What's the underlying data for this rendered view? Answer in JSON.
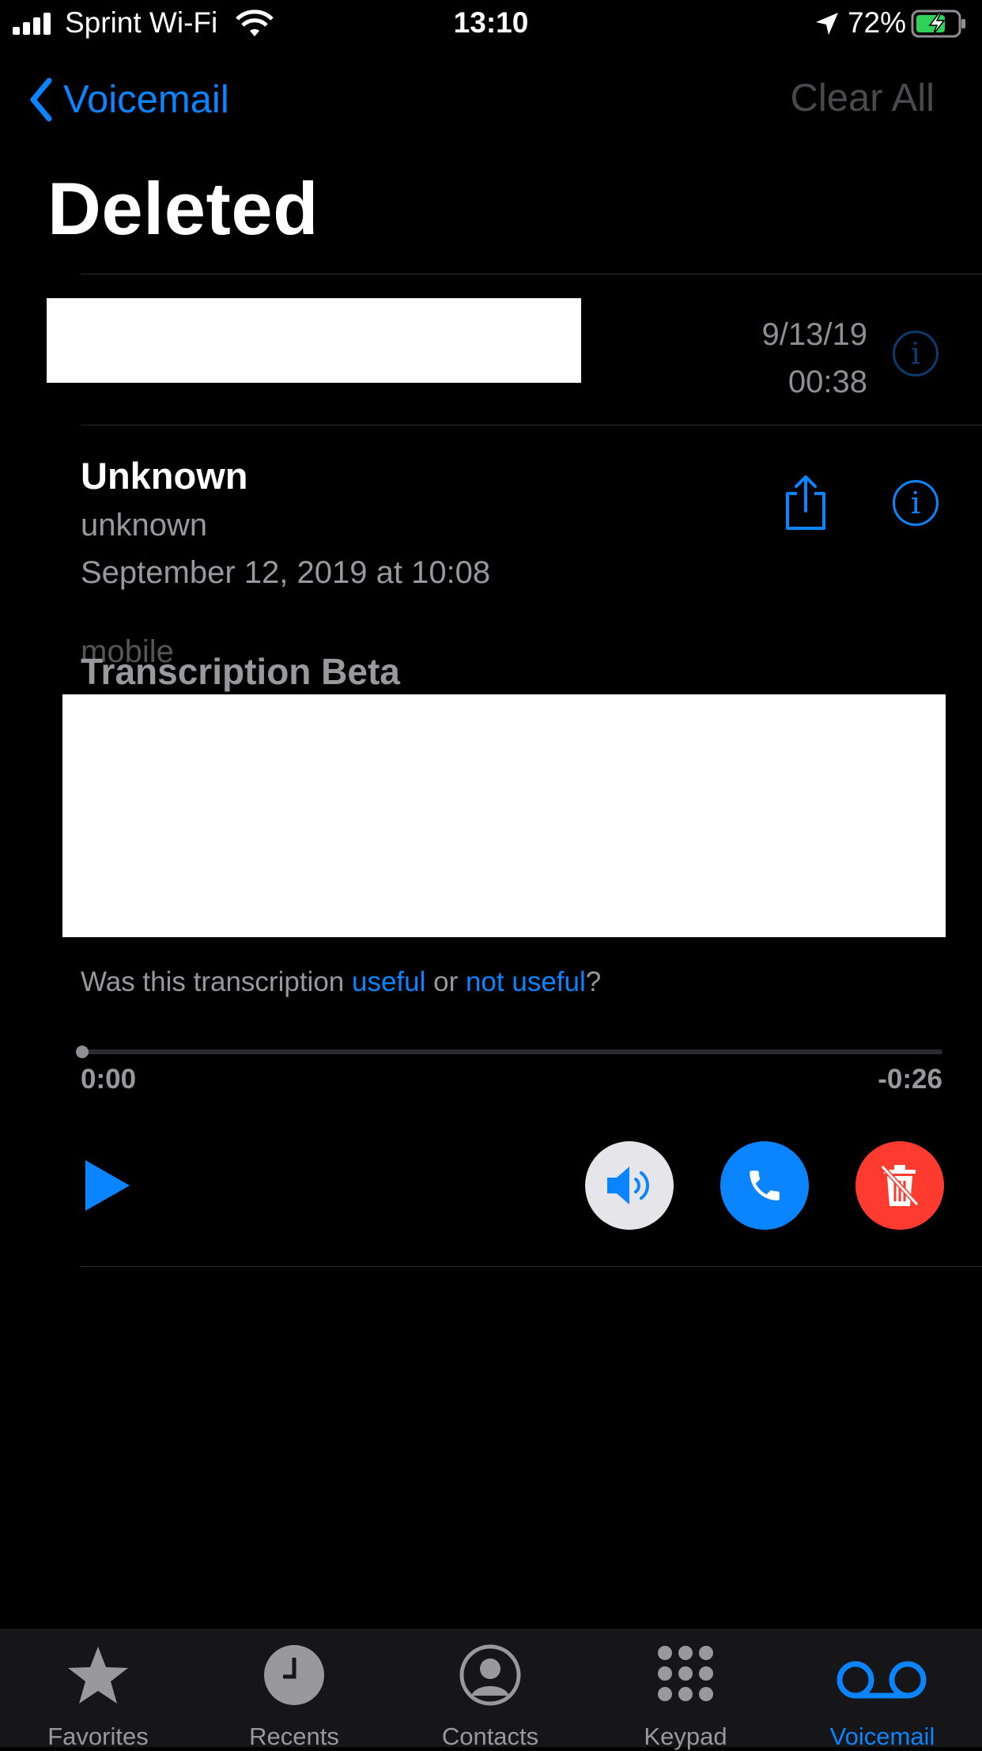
{
  "status": {
    "carrier": "Sprint Wi-Fi",
    "time": "13:10",
    "battery": "72%"
  },
  "nav": {
    "back_label": "Voicemail",
    "action_label": "Clear All",
    "title": "Deleted"
  },
  "list": [
    {
      "subtitle": "mobile",
      "date": "9/13/19",
      "duration": "00:38"
    }
  ],
  "expanded": {
    "name": "Unknown",
    "type": "unknown",
    "date": "September 12, 2019 at 10:08",
    "transcription_heading": "Transcription Beta",
    "feedback_prefix": "Was this transcription ",
    "feedback_useful": "useful",
    "feedback_or": " or ",
    "feedback_not_useful": "not useful",
    "feedback_suffix": "?",
    "elapsed": "0:00",
    "remaining": "-0:26",
    "progress": 0
  },
  "tabs": [
    {
      "label": "Favorites",
      "icon": "star-icon"
    },
    {
      "label": "Recents",
      "icon": "clock-icon"
    },
    {
      "label": "Contacts",
      "icon": "person-circle-icon"
    },
    {
      "label": "Keypad",
      "icon": "keypad-icon"
    },
    {
      "label": "Voicemail",
      "icon": "voicemail-icon",
      "active": true
    }
  ],
  "colors": {
    "accent": "#0a84ff",
    "delete": "#ff3b30",
    "speaker_bg": "#e5e5ea",
    "background": "#000000"
  }
}
